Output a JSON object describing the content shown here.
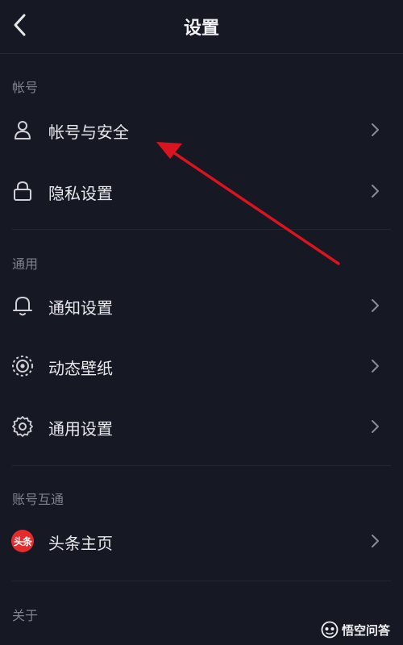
{
  "header": {
    "title": "设置"
  },
  "sections": [
    {
      "label": "帐号",
      "items": [
        {
          "label": "帐号与安全",
          "icon": "user-icon"
        },
        {
          "label": "隐私设置",
          "icon": "lock-icon"
        }
      ]
    },
    {
      "label": "通用",
      "items": [
        {
          "label": "通知设置",
          "icon": "bell-icon"
        },
        {
          "label": "动态壁纸",
          "icon": "live-wallpaper-icon"
        },
        {
          "label": "通用设置",
          "icon": "gear-icon"
        }
      ]
    },
    {
      "label": "账号互通",
      "items": [
        {
          "label": "头条主页",
          "icon": "toutiao-logo",
          "badge_text": "头条"
        }
      ]
    },
    {
      "label": "关于",
      "items": []
    }
  ],
  "watermark": {
    "text": "悟空问答"
  },
  "colors": {
    "background": "#161823",
    "annotation_arrow": "#d9141e",
    "badge": "#e52b2b"
  }
}
